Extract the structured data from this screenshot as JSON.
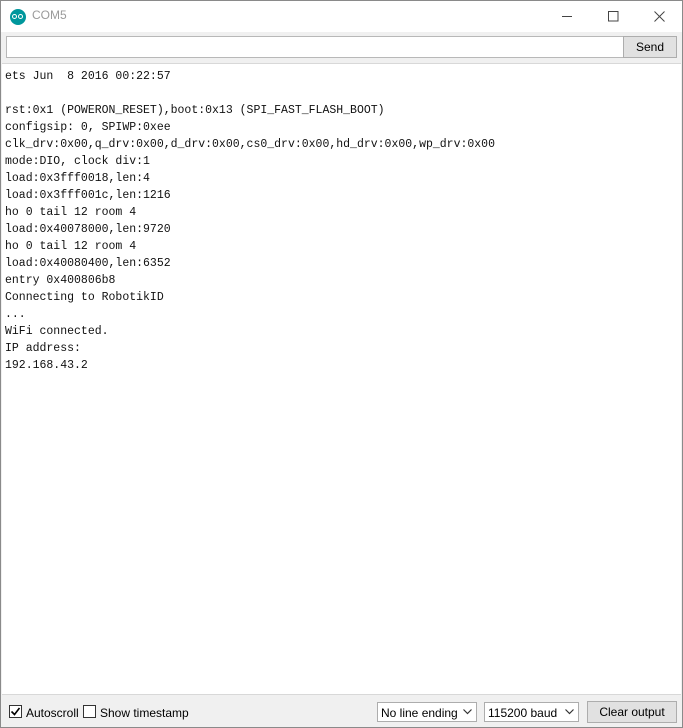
{
  "window": {
    "title": "COM5",
    "minimize_icon": "minimize-icon",
    "maximize_icon": "maximize-icon",
    "close_icon": "close-icon"
  },
  "toolbar": {
    "input_value": "",
    "input_placeholder": "",
    "send_label": "Send"
  },
  "console": {
    "lines": [
      "ets Jun  8 2016 00:22:57",
      "",
      "rst:0x1 (POWERON_RESET),boot:0x13 (SPI_FAST_FLASH_BOOT)",
      "configsip: 0, SPIWP:0xee",
      "clk_drv:0x00,q_drv:0x00,d_drv:0x00,cs0_drv:0x00,hd_drv:0x00,wp_drv:0x00",
      "mode:DIO, clock div:1",
      "load:0x3fff0018,len:4",
      "load:0x3fff001c,len:1216",
      "ho 0 tail 12 room 4",
      "load:0x40078000,len:9720",
      "ho 0 tail 12 room 4",
      "load:0x40080400,len:6352",
      "entry 0x400806b8",
      "Connecting to RobotikID",
      "...",
      "WiFi connected.",
      "IP address: ",
      "192.168.43.2"
    ],
    "annotation_color": "#3b9be8"
  },
  "statusbar": {
    "autoscroll_label": "Autoscroll",
    "autoscroll_checked": true,
    "timestamp_label": "Show timestamp",
    "timestamp_checked": false,
    "line_ending": "No line ending",
    "baud": "115200 baud",
    "clear_label": "Clear output"
  },
  "colors": {
    "app_icon": "#00979c"
  }
}
